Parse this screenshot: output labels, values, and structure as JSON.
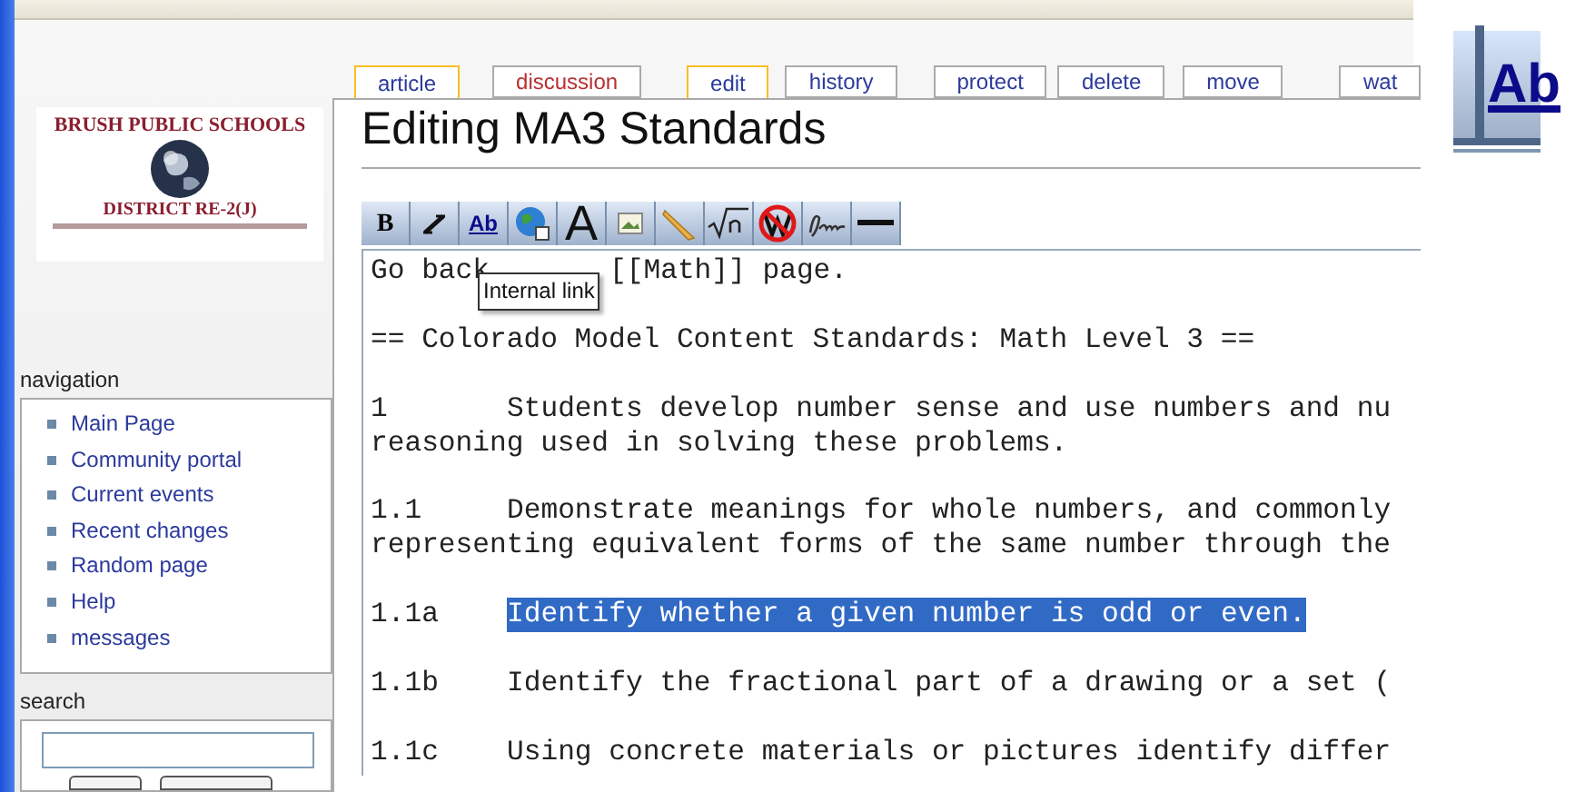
{
  "logo": {
    "title": "BRUSH PUBLIC SCHOOLS",
    "subtitle": "DISTRICT RE-2(J)"
  },
  "navigation": {
    "heading": "navigation",
    "items": [
      {
        "label": "Main Page"
      },
      {
        "label": "Community portal"
      },
      {
        "label": "Current events"
      },
      {
        "label": "Recent changes"
      },
      {
        "label": "Random page"
      },
      {
        "label": "Help"
      },
      {
        "label": "messages"
      }
    ]
  },
  "search": {
    "heading": "search"
  },
  "tabs": [
    {
      "label": "article",
      "selected": true,
      "missing": false
    },
    {
      "label": "discussion",
      "selected": false,
      "missing": true
    },
    {
      "label": "edit",
      "selected": true,
      "missing": false
    },
    {
      "label": "history",
      "selected": false,
      "missing": false
    },
    {
      "label": "protect",
      "selected": false,
      "missing": false
    },
    {
      "label": "delete",
      "selected": false,
      "missing": false
    },
    {
      "label": "move",
      "selected": false,
      "missing": false
    },
    {
      "label": "wat",
      "selected": false,
      "missing": false
    }
  ],
  "title": "Editing MA3 Standards",
  "toolbar": [
    {
      "kind": "bold",
      "label": "B"
    },
    {
      "kind": "italic"
    },
    {
      "kind": "link",
      "label": "Ab"
    },
    {
      "kind": "extlink"
    },
    {
      "kind": "headline",
      "label": "A"
    },
    {
      "kind": "image"
    },
    {
      "kind": "media"
    },
    {
      "kind": "math"
    },
    {
      "kind": "nowiki"
    },
    {
      "kind": "signature"
    },
    {
      "kind": "hr"
    }
  ],
  "tooltip": "Internal link",
  "editor": [
    {
      "kind": "covered",
      "before": "Go back",
      "after": "[[Math]] page."
    },
    {
      "kind": "plain",
      "lines": [
        "== Colorado Model Content Standards: Math Level 3 =="
      ]
    },
    {
      "kind": "numbered",
      "number": "1",
      "selected": false,
      "lines": [
        "Students develop number sense and use numbers and nu",
        "reasoning used in solving these problems."
      ]
    },
    {
      "kind": "numbered",
      "number": "1.1",
      "selected": false,
      "lines": [
        "Demonstrate meanings for whole numbers, and commonly",
        "representing equivalent forms of the same number through the"
      ]
    },
    {
      "kind": "numbered",
      "number": "1.1a",
      "selected": true,
      "lines": [
        "Identify whether a given number is odd or even."
      ]
    },
    {
      "kind": "numbered",
      "number": "1.1b",
      "selected": false,
      "lines": [
        "Identify the fractional part of a drawing or a set ("
      ]
    },
    {
      "kind": "numbered",
      "number": "1.1c",
      "selected": false,
      "lines": [
        "Using concrete materials or pictures identify differ"
      ]
    }
  ],
  "zoom_preview": {
    "label": "Ab"
  }
}
